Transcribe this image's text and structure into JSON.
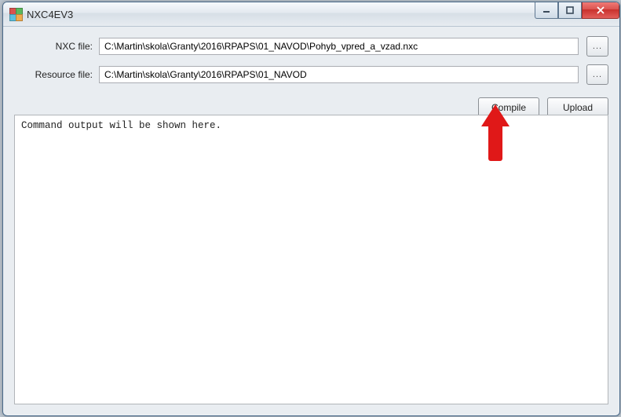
{
  "window": {
    "title": "NXC4EV3"
  },
  "form": {
    "nxc_label": "NXC file:",
    "nxc_value": "C:\\Martin\\skola\\Granty\\2016\\RPAPS\\01_NAVOD\\Pohyb_vpred_a_vzad.nxc",
    "resource_label": "Resource file:",
    "resource_value": "C:\\Martin\\skola\\Granty\\2016\\RPAPS\\01_NAVOD",
    "browse_label": "..."
  },
  "buttons": {
    "compile": "Compile",
    "upload": "Upload"
  },
  "output": {
    "placeholder": "Command output will be shown here."
  },
  "annotation": {
    "arrow_target": "compile-button"
  }
}
